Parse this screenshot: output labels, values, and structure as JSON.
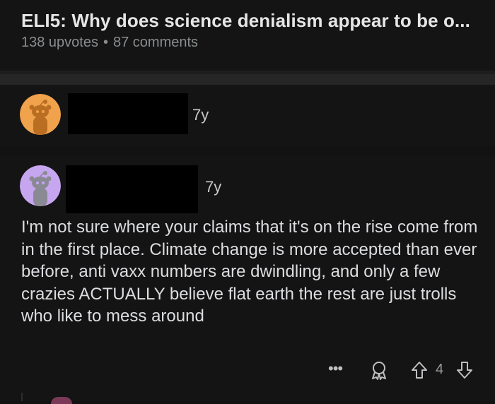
{
  "post": {
    "title": "ELI5: Why does science denialism appear to be o...",
    "upvotes": "138 upvotes",
    "separator": "•",
    "comments": "87 comments"
  },
  "comments": [
    {
      "avatar_color": "#f0a24c",
      "avatar_icon": "snoo-avatar-icon",
      "username_redacted": true,
      "age": "7y"
    },
    {
      "avatar_color": "#c7a6f0",
      "avatar_icon": "snoo-avatar-icon",
      "username_redacted": true,
      "age": "7y",
      "body": "I'm not sure where your claims that it's on the rise come from in the first place. Climate change is more accepted than ever before, anti vaxx numbers are dwindling, and only a few crazies ACTUALLY believe flat earth the rest are just trolls who like to mess around",
      "actions": {
        "more_label": "•••",
        "award_icon": "award-icon",
        "upvote_icon": "upvote-arrow-icon",
        "score": "4",
        "downvote_icon": "downvote-arrow-icon"
      }
    }
  ],
  "colors": {
    "background": "#121212",
    "divider": "#262626",
    "text_primary": "#dcdde0",
    "text_meta": "#8a8d90"
  }
}
